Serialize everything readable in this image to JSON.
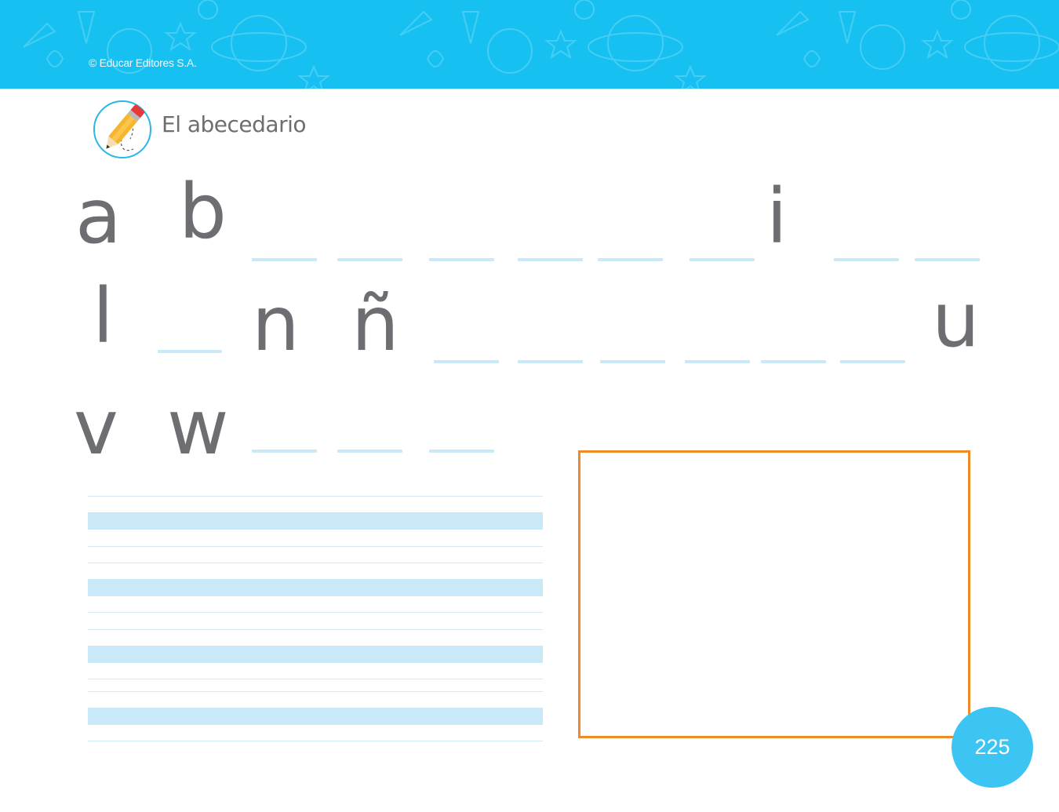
{
  "header": {
    "copyright": "© Educar Editores S.A.",
    "background_color": "#16c0f1"
  },
  "section": {
    "title": "El abecedario",
    "icon": "pencil-icon"
  },
  "alphabet": {
    "row1": [
      "a",
      "b",
      "i"
    ],
    "row2": [
      "l",
      "n",
      "ñ",
      "u"
    ],
    "row3": [
      "v",
      "w"
    ]
  },
  "drawing_box": {
    "border_color": "#ef8a2b"
  },
  "footer": {
    "page_number": "225",
    "badge_color": "#3cc4f2"
  }
}
